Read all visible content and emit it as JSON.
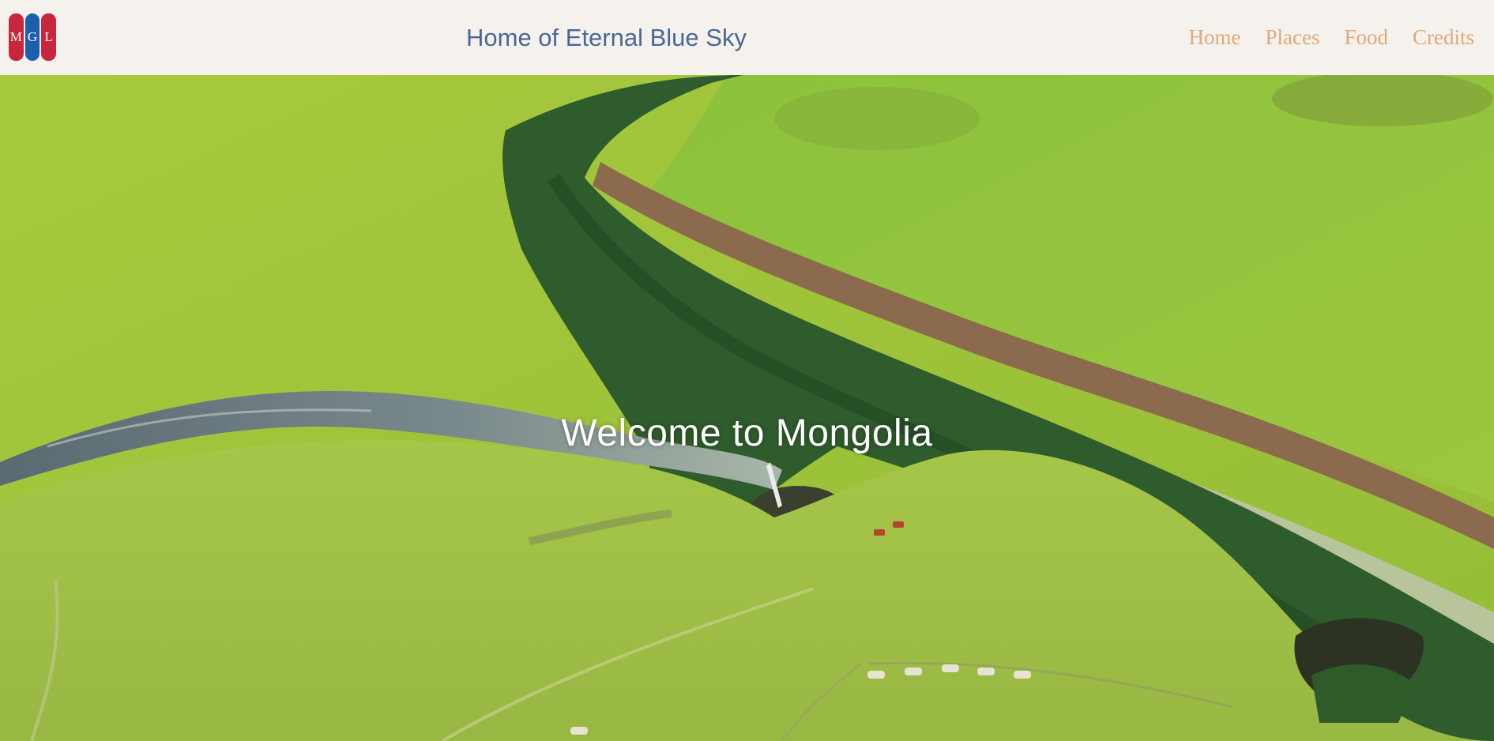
{
  "header": {
    "logo_letters": [
      "M",
      "G",
      "L"
    ],
    "title": "Home of Eternal Blue Sky",
    "colors": {
      "background": "#f5f2ee",
      "title": "#4a6894",
      "nav": "#e2a877",
      "logo_red": "#c8263a",
      "logo_blue": "#1b5fae"
    }
  },
  "nav": {
    "items": [
      {
        "label": "Home"
      },
      {
        "label": "Places"
      },
      {
        "label": "Food"
      },
      {
        "label": "Credits"
      }
    ]
  },
  "hero": {
    "heading": "Welcome to Mongolia",
    "image_description": "aerial-view-of-green-steppe-river-canyon-waterfall-and-yurts"
  }
}
